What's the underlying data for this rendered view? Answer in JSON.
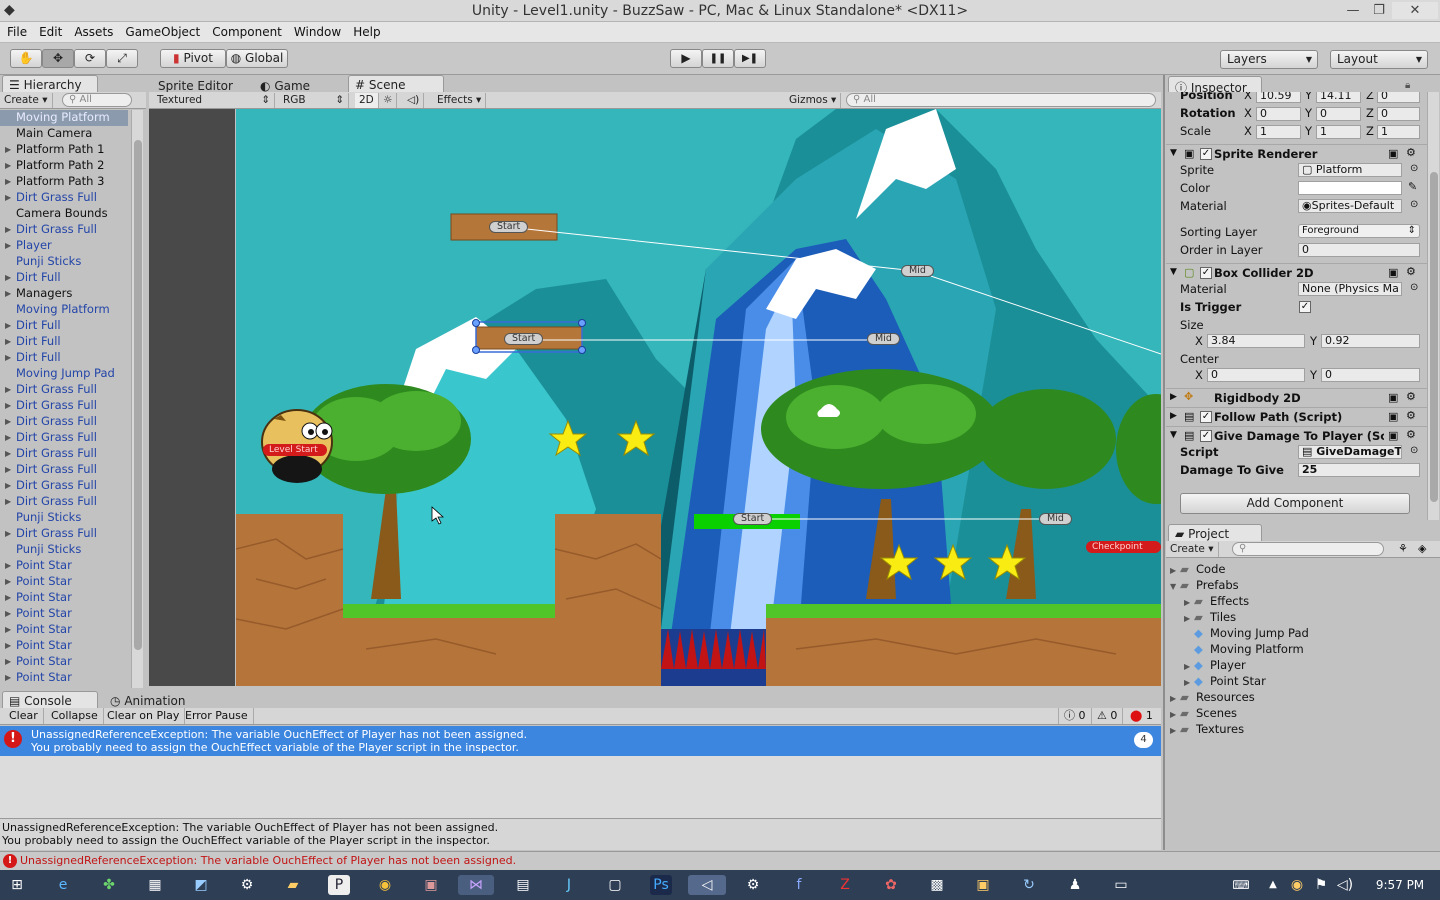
{
  "window": {
    "title": "Unity - Level1.unity - BuzzSaw - PC, Mac & Linux Standalone* <DX11>",
    "min": "—",
    "max": "❐",
    "close": "✕"
  },
  "menu": [
    "File",
    "Edit",
    "Assets",
    "GameObject",
    "Component",
    "Window",
    "Help"
  ],
  "toolbar": {
    "pivot": "Pivot",
    "global": "Global",
    "layers": "Layers",
    "layout": "Layout",
    "play": "▶",
    "pause": "❚❚",
    "step": "▶❚"
  },
  "hierarchy": {
    "tab": "Hierarchy",
    "create": "Create",
    "search": "All",
    "items": [
      {
        "label": "Moving Platform",
        "prefab": true,
        "arrow": false,
        "selected": true
      },
      {
        "label": "Main Camera",
        "prefab": false,
        "arrow": false
      },
      {
        "label": "Platform Path 1",
        "prefab": false,
        "arrow": true
      },
      {
        "label": "Platform Path 2",
        "prefab": false,
        "arrow": true
      },
      {
        "label": "Platform Path 3",
        "prefab": false,
        "arrow": true
      },
      {
        "label": "Dirt Grass Full",
        "prefab": true,
        "arrow": true
      },
      {
        "label": "Camera Bounds",
        "prefab": false,
        "arrow": false
      },
      {
        "label": "Dirt Grass Full",
        "prefab": true,
        "arrow": true
      },
      {
        "label": "Player",
        "prefab": true,
        "arrow": true
      },
      {
        "label": "Punji Sticks",
        "prefab": true,
        "arrow": false
      },
      {
        "label": "Dirt Full",
        "prefab": true,
        "arrow": true
      },
      {
        "label": "Managers",
        "prefab": false,
        "arrow": true
      },
      {
        "label": "Moving Platform",
        "prefab": true,
        "arrow": false
      },
      {
        "label": "Dirt Full",
        "prefab": true,
        "arrow": true
      },
      {
        "label": "Dirt Full",
        "prefab": true,
        "arrow": true
      },
      {
        "label": "Dirt Full",
        "prefab": true,
        "arrow": true
      },
      {
        "label": "Moving Jump Pad",
        "prefab": true,
        "arrow": false
      },
      {
        "label": "Dirt Grass Full",
        "prefab": true,
        "arrow": true
      },
      {
        "label": "Dirt Grass Full",
        "prefab": true,
        "arrow": true
      },
      {
        "label": "Dirt Grass Full",
        "prefab": true,
        "arrow": true
      },
      {
        "label": "Dirt Grass Full",
        "prefab": true,
        "arrow": true
      },
      {
        "label": "Dirt Grass Full",
        "prefab": true,
        "arrow": true
      },
      {
        "label": "Dirt Grass Full",
        "prefab": true,
        "arrow": true
      },
      {
        "label": "Dirt Grass Full",
        "prefab": true,
        "arrow": true
      },
      {
        "label": "Dirt Grass Full",
        "prefab": true,
        "arrow": true
      },
      {
        "label": "Punji Sticks",
        "prefab": true,
        "arrow": false
      },
      {
        "label": "Dirt Grass Full",
        "prefab": true,
        "arrow": true
      },
      {
        "label": "Punji Sticks",
        "prefab": true,
        "arrow": false
      },
      {
        "label": "Point Star",
        "prefab": true,
        "arrow": true
      },
      {
        "label": "Point Star",
        "prefab": true,
        "arrow": true
      },
      {
        "label": "Point Star",
        "prefab": true,
        "arrow": true
      },
      {
        "label": "Point Star",
        "prefab": true,
        "arrow": true
      },
      {
        "label": "Point Star",
        "prefab": true,
        "arrow": true
      },
      {
        "label": "Point Star",
        "prefab": true,
        "arrow": true
      },
      {
        "label": "Point Star",
        "prefab": true,
        "arrow": true
      },
      {
        "label": "Point Star",
        "prefab": true,
        "arrow": true
      }
    ]
  },
  "scene_tabs": {
    "sprite_editor": "Sprite Editor",
    "game": "Game",
    "scene": "Scene"
  },
  "scene_bar": {
    "textured": "Textured",
    "rgb": "RGB",
    "mode2d": "2D",
    "effects": "Effects",
    "gizmos": "Gizmos",
    "search": "All"
  },
  "scene_labels": {
    "start": "Start",
    "mid": "Mid",
    "level_start": "Level Start",
    "checkpoint": "Checkpoint"
  },
  "inspector": {
    "tab": "Inspector",
    "transform": {
      "position_label": "Position",
      "rotation_label": "Rotation",
      "scale_label": "Scale",
      "pos": [
        "10.59",
        "14.11",
        "0"
      ],
      "rot": [
        "0",
        "0",
        "0"
      ],
      "scale": [
        "1",
        "1",
        "1"
      ]
    },
    "sprite_renderer": {
      "title": "Sprite Renderer",
      "sprite_label": "Sprite",
      "sprite": "Platform",
      "color_label": "Color",
      "material_label": "Material",
      "material": "Sprites-Default",
      "sorting_label": "Sorting Layer",
      "sorting": "Foreground",
      "order_label": "Order in Layer",
      "order": "0"
    },
    "box_collider": {
      "title": "Box Collider 2D",
      "material_label": "Material",
      "material": "None (Physics Ma",
      "trigger_label": "Is Trigger",
      "size_label": "Size",
      "size": [
        "3.84",
        "0.92"
      ],
      "center_label": "Center",
      "center": [
        "0",
        "0"
      ]
    },
    "rigidbody": {
      "title": "Rigidbody 2D"
    },
    "follow_path": {
      "title": "Follow Path (Script)"
    },
    "give_damage": {
      "title": "Give Damage To Player (Sc",
      "script_label": "Script",
      "script": "GiveDamageT",
      "damage_label": "Damage To Give",
      "damage": "25"
    },
    "add_component": "Add Component"
  },
  "project": {
    "tab": "Project",
    "create": "Create",
    "items": [
      {
        "label": "Code",
        "indent": 0,
        "arrow": "▶",
        "type": "folder"
      },
      {
        "label": "Prefabs",
        "indent": 0,
        "arrow": "▼",
        "type": "folder"
      },
      {
        "label": "Effects",
        "indent": 1,
        "arrow": "▶",
        "type": "folder"
      },
      {
        "label": "Tiles",
        "indent": 1,
        "arrow": "▶",
        "type": "folder"
      },
      {
        "label": "Moving Jump Pad",
        "indent": 1,
        "arrow": "",
        "type": "prefab"
      },
      {
        "label": "Moving Platform",
        "indent": 1,
        "arrow": "",
        "type": "prefab"
      },
      {
        "label": "Player",
        "indent": 1,
        "arrow": "▶",
        "type": "prefab"
      },
      {
        "label": "Point Star",
        "indent": 1,
        "arrow": "▶",
        "type": "prefab"
      },
      {
        "label": "Resources",
        "indent": 0,
        "arrow": "▶",
        "type": "folder"
      },
      {
        "label": "Scenes",
        "indent": 0,
        "arrow": "▶",
        "type": "folder"
      },
      {
        "label": "Textures",
        "indent": 0,
        "arrow": "▶",
        "type": "folder"
      }
    ]
  },
  "console": {
    "tab": "Console",
    "animation_tab": "Animation",
    "clear": "Clear",
    "collapse": "Collapse",
    "clear_on_play": "Clear on Play",
    "error_pause": "Error Pause",
    "log_count": "0",
    "warn_count": "0",
    "err_count": "1",
    "entry_line1": "UnassignedReferenceException: The variable OuchEffect of Player has not been assigned.",
    "entry_line2": "You probably need to assign the OuchEffect variable of the Player script in the inspector.",
    "entry_count": "4",
    "detail_line1": "UnassignedReferenceException: The variable OuchEffect of Player has not been assigned.",
    "detail_line2": "You probably need to assign the OuchEffect variable of the Player script in the inspector."
  },
  "status": {
    "text": "UnassignedReferenceException: The variable OuchEffect of Player has not been assigned."
  },
  "taskbar": {
    "time": "9:57 PM"
  }
}
